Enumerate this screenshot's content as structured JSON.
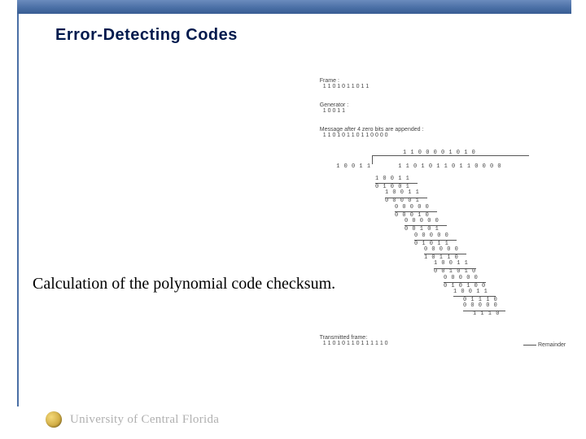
{
  "title": "Error-Detecting Codes",
  "caption": "Calculation of the polynomial code checksum.",
  "footer": {
    "org": "University of Central Florida"
  },
  "diagram": {
    "frame_label": "Frame :",
    "frame_value": "1 1 0 1 0 1 1 0 1 1",
    "generator_label": "Generator :",
    "generator_value": "1 0 0 1 1",
    "appended_label": "Message after 4 zero bits are appended :",
    "appended_value": "1 1 0 1 0 1 1 0 1 1 0 0 0 0",
    "quotient": "1 1 0 0 0 0 1 0 1 0",
    "divisor": "1 0 0 1 1",
    "dividend": "1 1 0 1 0 1 1 0 1 1 0 0 0 0",
    "steps": [
      {
        "sub": "1 0 0 1 1",
        "indent": 76,
        "rw": 52,
        "res": "0 1 0 0 1",
        "res_indent": 76
      },
      {
        "sub": "1 0 0 1 1",
        "indent": 88,
        "rw": 52,
        "res": "0 0 0 0 1",
        "res_indent": 88
      },
      {
        "sub": "0 0 0 0 0",
        "indent": 100,
        "rw": 52,
        "res": "0 0 0 1 0",
        "res_indent": 100
      },
      {
        "sub": "0 0 0 0 0",
        "indent": 112,
        "rw": 52,
        "res": "0 0 1 0 1",
        "res_indent": 112
      },
      {
        "sub": "0 0 0 0 0",
        "indent": 124,
        "rw": 52,
        "res": "0 1 0 1 1",
        "res_indent": 124
      },
      {
        "sub": "0 0 0 0 0",
        "indent": 136,
        "rw": 52,
        "res": "1 0 1 1 0",
        "res_indent": 136
      },
      {
        "sub": "1 0 0 1 1",
        "indent": 148,
        "rw": 52,
        "res": "0 0 1 0 1 0",
        "res_indent": 148
      },
      {
        "sub": "0 0 0 0 0",
        "indent": 160,
        "rw": 52,
        "res": "0 1 0 1 0 0",
        "res_indent": 160
      },
      {
        "sub": "1 0 0 1 1",
        "indent": 172,
        "rw": 52,
        "res": "0 1 1 1 0",
        "res_indent": 184
      },
      {
        "sub": "0 0 0 0 0",
        "indent": 184,
        "rw": 52,
        "res": "1 1 1 0",
        "res_indent": 196
      }
    ],
    "remainder_label": "Remainder",
    "transmitted_label": "Transmitted frame:",
    "transmitted_value": "1 1 0 1 0 1 1 0 1 1 1 1 1 0"
  }
}
